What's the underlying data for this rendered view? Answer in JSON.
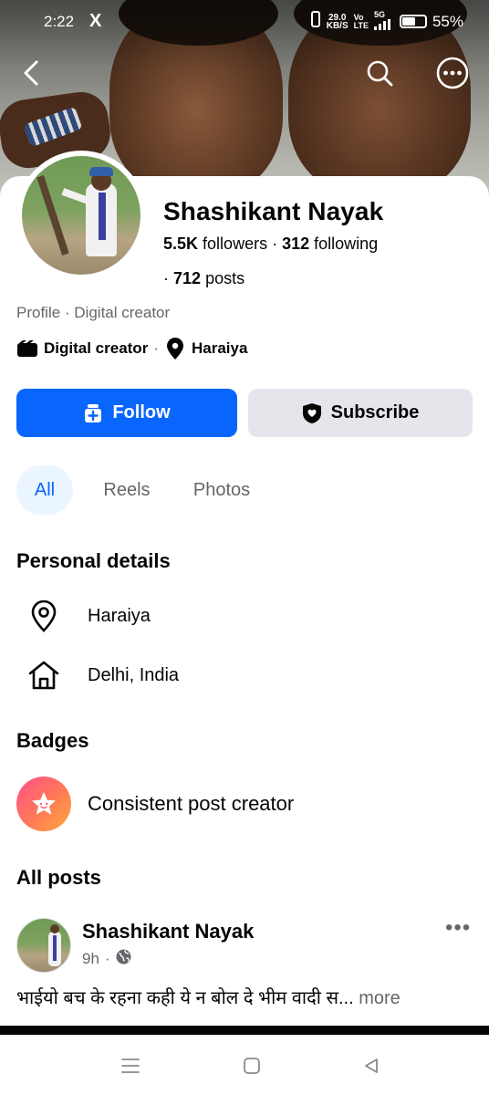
{
  "status_bar": {
    "time": "2:22",
    "app_icon": "X",
    "speed_value": "29.0",
    "speed_unit": "KB/S",
    "net_top": "Vo",
    "net_bottom": "LTE",
    "signal": "5G",
    "battery": "55%"
  },
  "profile": {
    "name": "Shashikant Nayak",
    "followers_count": "5.5K",
    "followers_label": "followers",
    "following_count": "312",
    "following_label": "following",
    "posts_prefix": "·",
    "posts_count": "712",
    "posts_label": "posts",
    "category_line": "Profile · Digital creator",
    "chip_category": "Digital creator",
    "chip_location": "Haraiya"
  },
  "actions": {
    "follow_label": "Follow",
    "subscribe_label": "Subscribe"
  },
  "tabs": [
    {
      "label": "All",
      "active": true
    },
    {
      "label": "Reels",
      "active": false
    },
    {
      "label": "Photos",
      "active": false
    }
  ],
  "personal_details": {
    "heading": "Personal details",
    "items": [
      {
        "icon": "location-pin-icon",
        "text": "Haraiya"
      },
      {
        "icon": "home-icon",
        "text": "Delhi, India"
      }
    ]
  },
  "badges": {
    "heading": "Badges",
    "items": [
      {
        "icon": "star-badge-icon",
        "text": "Consistent post creator"
      }
    ]
  },
  "posts": {
    "heading": "All posts",
    "first": {
      "author": "Shashikant Nayak",
      "time": "9h",
      "separator": "·",
      "text": "भाईयो बच के  रहना कही ये न बोल दे भीम वादी स...",
      "more": "more"
    }
  },
  "colors": {
    "accent": "#0866ff",
    "secondary_button": "#e4e6eb",
    "muted_text": "#65676b",
    "active_tab_bg": "#ebf5ff"
  }
}
